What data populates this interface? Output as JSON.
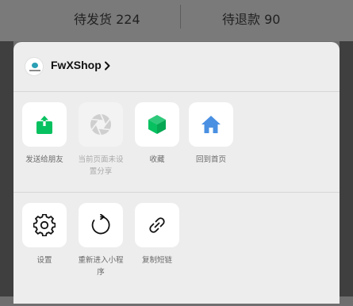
{
  "background": {
    "stat_left": "待发货 224",
    "stat_right": "待退款 90"
  },
  "sheet": {
    "shop_name": "FwXShop",
    "row1": [
      {
        "label": "发送给朋友",
        "icon": "share-up-icon",
        "color": "#07c160"
      },
      {
        "label": "当前页面未设置分享",
        "icon": "shutter-icon",
        "disabled": true
      },
      {
        "label": "收藏",
        "icon": "cube-icon",
        "color": "#07c160"
      },
      {
        "label": "回到首页",
        "icon": "home-icon",
        "color": "#4a90e2"
      }
    ],
    "row2": [
      {
        "label": "设置",
        "icon": "gear-icon"
      },
      {
        "label": "重新进入小程序",
        "icon": "refresh-icon"
      },
      {
        "label": "复制短链",
        "icon": "link-icon"
      }
    ]
  }
}
